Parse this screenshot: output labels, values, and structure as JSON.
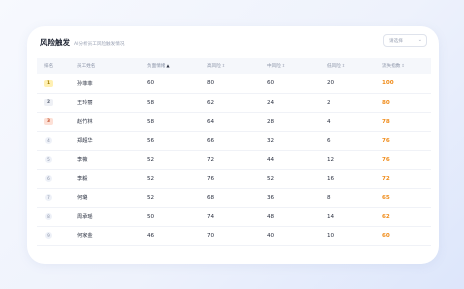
{
  "header": {
    "title": "风险触发",
    "subtitle": "AI分析员工风险触发情况",
    "select_placeholder": "请选择"
  },
  "table": {
    "columns": [
      {
        "label": "排名",
        "sort": ""
      },
      {
        "label": "员工姓名",
        "sort": ""
      },
      {
        "label": "负面情绪",
        "sort": "▲"
      },
      {
        "label": "高风险",
        "sort": "⇕"
      },
      {
        "label": "中风险",
        "sort": "⇕"
      },
      {
        "label": "低风险",
        "sort": "⇕"
      },
      {
        "label": "流失指数",
        "sort": "⇕"
      }
    ],
    "rows": [
      {
        "rank": "1",
        "name": "孙菲菲",
        "negative": "60",
        "high": "80",
        "mid": "60",
        "low": "20",
        "score": "100"
      },
      {
        "rank": "2",
        "name": "王玲丽",
        "negative": "58",
        "high": "62",
        "mid": "24",
        "low": "2",
        "score": "80"
      },
      {
        "rank": "3",
        "name": "赵竹林",
        "negative": "58",
        "high": "64",
        "mid": "28",
        "low": "4",
        "score": "78"
      },
      {
        "rank": "4",
        "name": "郑超华",
        "negative": "56",
        "high": "66",
        "mid": "32",
        "low": "6",
        "score": "76"
      },
      {
        "rank": "5",
        "name": "李薇",
        "negative": "52",
        "high": "72",
        "mid": "44",
        "low": "12",
        "score": "76"
      },
      {
        "rank": "6",
        "name": "李毅",
        "negative": "52",
        "high": "76",
        "mid": "52",
        "low": "16",
        "score": "72"
      },
      {
        "rank": "7",
        "name": "何璐",
        "negative": "52",
        "high": "68",
        "mid": "36",
        "low": "8",
        "score": "65"
      },
      {
        "rank": "8",
        "name": "周承瑶",
        "negative": "50",
        "high": "74",
        "mid": "48",
        "low": "14",
        "score": "62"
      },
      {
        "rank": "9",
        "name": "何家金",
        "negative": "46",
        "high": "70",
        "mid": "40",
        "low": "10",
        "score": "60"
      }
    ]
  }
}
